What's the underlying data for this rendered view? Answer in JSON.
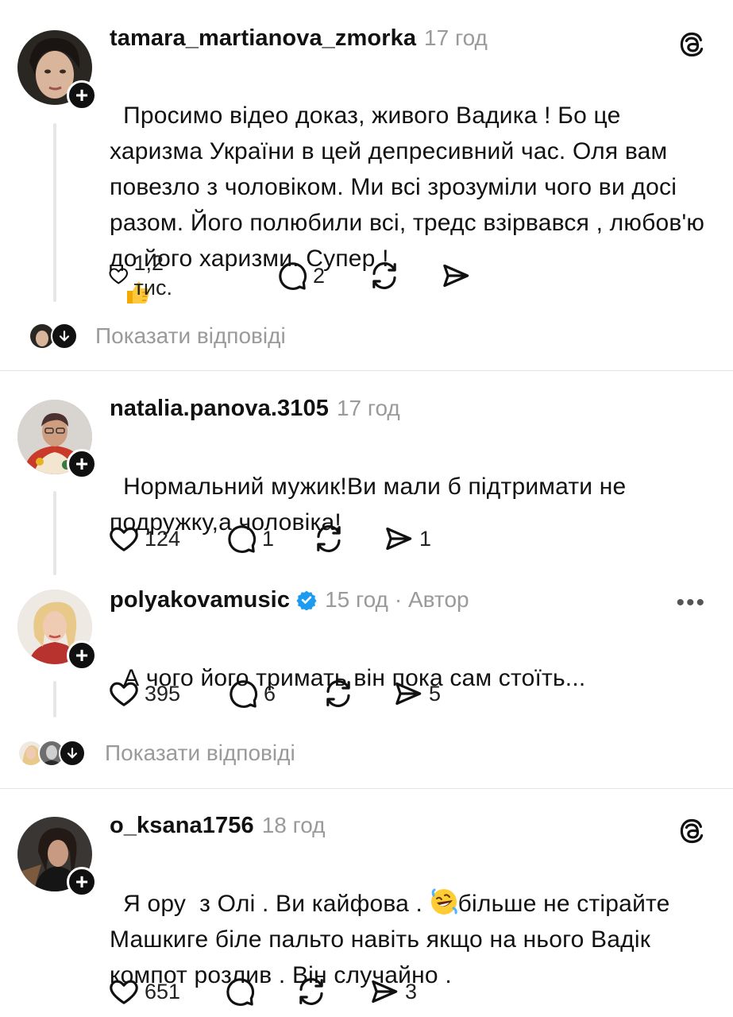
{
  "comments": [
    {
      "username": "tamara_martianova_zmorka",
      "time": "17 год",
      "text": "Просимо відео доказ, живого Вадика ! Бо це харизма України в цей депресивний час. Оля вам повезло з чоловіком. Ми всі зрозуміли чого ви досі разом. Його полюбили всі, тредс взірвався , любов'ю до його харизми. Супер !",
      "emoji": "thumbs-up",
      "likes": "1,2 тис.",
      "replies": "2",
      "reposts": "",
      "shares": "",
      "corner_icon": "threads-logo-icon"
    },
    {
      "username": "natalia.panova.3105",
      "time": "17 год",
      "text": "Нормальний мужик!Ви мали б підтримати не подружку,а чоловіка!",
      "likes": "124",
      "replies": "1",
      "reposts": "",
      "shares": "1"
    },
    {
      "username": "polyakovamusic",
      "time": "15 год",
      "author_badge": "· Автор",
      "verified": true,
      "text": "А чого його тримать він пока сам стоїть...",
      "likes": "395",
      "replies": "6",
      "reposts": "",
      "shares": "5",
      "corner_icon": "more-options-icon"
    },
    {
      "username": "o_ksana1756",
      "time": "18 год",
      "text_before_emoji": "Я ору  з Олі . Ви кайфова . ",
      "emoji": "rolling-laughing",
      "text_after_emoji": "більше не стірайте Машкиге біле пальто навіть якщо на нього Вадік компот розлив . Він случайно .",
      "likes": "651",
      "replies": "",
      "reposts": "",
      "shares": "3",
      "corner_icon": "threads-logo-icon"
    }
  ],
  "show_replies_label": "Показати відповіді",
  "more_dots": "•••",
  "plus_symbol": "+",
  "colors": {
    "text": "#111111",
    "muted": "#9a9a9a",
    "verified": "#1d9bf0",
    "divider": "#e3e3e3"
  }
}
